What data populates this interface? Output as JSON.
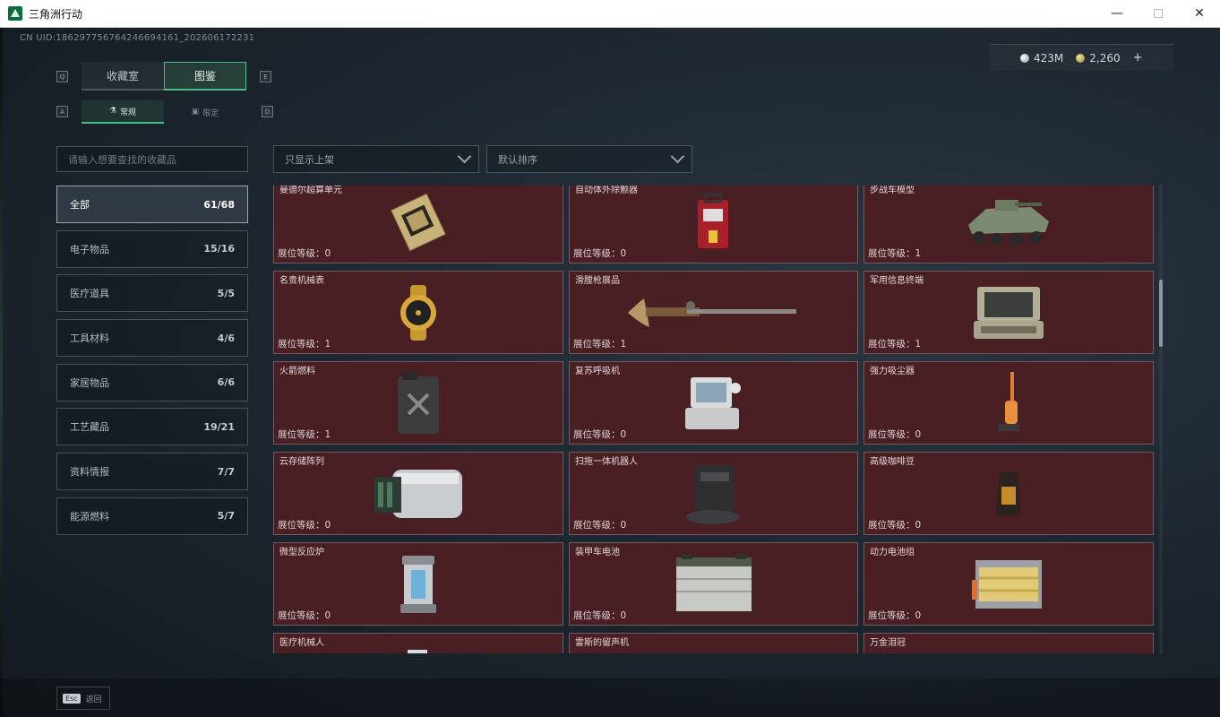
{
  "window": {
    "title": "三角洲行动",
    "minimize": "—",
    "close": "✕"
  },
  "header": {
    "uid": "CN UID:186297756764246694161_202606172231",
    "currency": {
      "silver": "423M",
      "gold": "2,260",
      "plus": "+"
    }
  },
  "tabs_top": {
    "key_left": "Q",
    "key_right": "E",
    "items": [
      {
        "label": "收藏室",
        "active": false
      },
      {
        "label": "图鉴",
        "active": true
      }
    ]
  },
  "tabs_sub": {
    "key_left": "A",
    "key_right": "D",
    "items": [
      {
        "label": "常规",
        "active": true
      },
      {
        "label": "限定",
        "active": false
      }
    ]
  },
  "search": {
    "placeholder": "请输入想要查找的收藏品"
  },
  "filters": {
    "shelf": "只显示上架",
    "sort": "默认排序"
  },
  "categories": [
    {
      "label": "全部",
      "count": "61/68",
      "active": true
    },
    {
      "label": "电子物品",
      "count": "15/16",
      "active": false
    },
    {
      "label": "医疗道具",
      "count": "5/5",
      "active": false
    },
    {
      "label": "工具材料",
      "count": "4/6",
      "active": false
    },
    {
      "label": "家居物品",
      "count": "6/6",
      "active": false
    },
    {
      "label": "工艺藏品",
      "count": "19/21",
      "active": false
    },
    {
      "label": "资料情报",
      "count": "7/7",
      "active": false
    },
    {
      "label": "能源燃料",
      "count": "5/7",
      "active": false
    }
  ],
  "items": [
    {
      "name": "曼德尔超算单元",
      "level": "展位等级：0",
      "icon": "cpu-icon"
    },
    {
      "name": "自动体外除颤器",
      "level": "展位等级：0",
      "icon": "defibrillator-icon"
    },
    {
      "name": "步战车模型",
      "level": "展位等级：1",
      "icon": "ifv-model-icon"
    },
    {
      "name": "名贵机械表",
      "level": "展位等级：1",
      "icon": "watch-icon"
    },
    {
      "name": "滑膛枪展品",
      "level": "展位等级：1",
      "icon": "musket-icon"
    },
    {
      "name": "军用信息终端",
      "level": "展位等级：1",
      "icon": "terminal-icon"
    },
    {
      "name": "火箭燃料",
      "level": "展位等级：1",
      "icon": "fuel-can-icon"
    },
    {
      "name": "复苏呼吸机",
      "level": "展位等级：0",
      "icon": "ventilator-icon"
    },
    {
      "name": "强力吸尘器",
      "level": "展位等级：0",
      "icon": "vacuum-icon"
    },
    {
      "name": "云存储阵列",
      "level": "展位等级：0",
      "icon": "server-array-icon"
    },
    {
      "name": "扫拖一体机器人",
      "level": "展位等级：0",
      "icon": "robot-vacuum-icon"
    },
    {
      "name": "高级咖啡豆",
      "level": "展位等级：0",
      "icon": "coffee-bag-icon"
    },
    {
      "name": "微型反应炉",
      "level": "展位等级：0",
      "icon": "reactor-icon"
    },
    {
      "name": "装甲车电池",
      "level": "展位等级：0",
      "icon": "battery-icon"
    },
    {
      "name": "动力电池组",
      "level": "展位等级：0",
      "icon": "battery-pack-icon"
    },
    {
      "name": "医疗机械人",
      "level": "",
      "icon": "medical-robot-icon"
    },
    {
      "name": "雷斯的留声机",
      "level": "",
      "icon": "gramophone-icon"
    },
    {
      "name": "万金泪冠",
      "level": "",
      "icon": "crown-icon"
    }
  ],
  "footer": {
    "key": "Esc",
    "label": "返回"
  }
}
